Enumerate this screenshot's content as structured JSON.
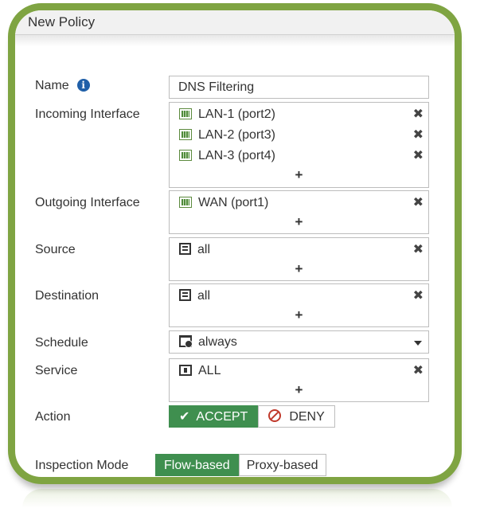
{
  "window": {
    "title": "New Policy"
  },
  "form": {
    "name": {
      "label": "Name",
      "value": "DNS Filtering"
    },
    "incoming": {
      "label": "Incoming Interface",
      "items": [
        "LAN-1 (port2)",
        "LAN-2 (port3)",
        "LAN-3 (port4)"
      ],
      "add": "+"
    },
    "outgoing": {
      "label": "Outgoing Interface",
      "items": [
        "WAN (port1)"
      ],
      "add": "+"
    },
    "source": {
      "label": "Source",
      "items": [
        "all"
      ],
      "add": "+"
    },
    "destination": {
      "label": "Destination",
      "items": [
        "all"
      ],
      "add": "+"
    },
    "schedule": {
      "label": "Schedule",
      "value": "always"
    },
    "service": {
      "label": "Service",
      "items": [
        "ALL"
      ],
      "add": "+"
    },
    "action": {
      "label": "Action",
      "accept": "ACCEPT",
      "deny": "DENY",
      "selected": "ACCEPT"
    },
    "inspection": {
      "label": "Inspection Mode",
      "flow": "Flow-based",
      "proxy": "Proxy-based",
      "selected": "Flow-based"
    },
    "remove_glyph": "✖",
    "check_glyph": "✔",
    "info_glyph": "i"
  },
  "icons": {
    "info": "info-icon",
    "interface": "port-icon",
    "address": "address-icon",
    "schedule": "schedule-icon",
    "service": "service-icon",
    "remove": "remove-icon",
    "add": "add-icon",
    "dropdown": "chevron-down-icon",
    "accept": "check-icon",
    "deny": "deny-icon"
  },
  "colors": {
    "frame_border": "#7fa442",
    "active_button": "#3f8f4f",
    "deny_icon": "#c0392b",
    "info_icon": "#1f5fa8"
  }
}
